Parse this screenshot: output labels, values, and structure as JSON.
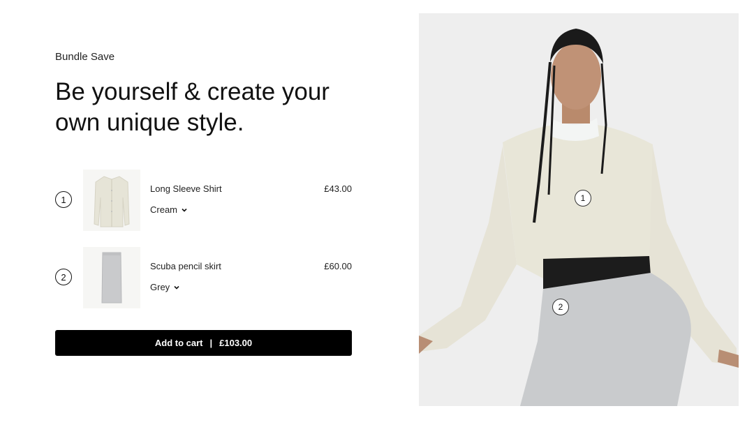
{
  "bundle": {
    "eyebrow": "Bundle Save",
    "headline": "Be yourself & create your own unique style."
  },
  "items": [
    {
      "number": "1",
      "name": "Long Sleeve Shirt",
      "price": "£43.00",
      "variant": "Cream",
      "thumb_icon": "cardigan-thumbnail"
    },
    {
      "number": "2",
      "name": "Scuba pencil skirt",
      "price": "£60.00",
      "variant": "Grey",
      "thumb_icon": "skirt-thumbnail"
    }
  ],
  "cart": {
    "label": "Add to cart",
    "separator": "|",
    "total": "£103.00"
  },
  "hero": {
    "hotspots": [
      "1",
      "2"
    ]
  },
  "colors": {
    "button_bg": "#000000",
    "cream": "#e7e5d8",
    "grey": "#c9cacc",
    "hero_bg": "#eeeeee"
  }
}
